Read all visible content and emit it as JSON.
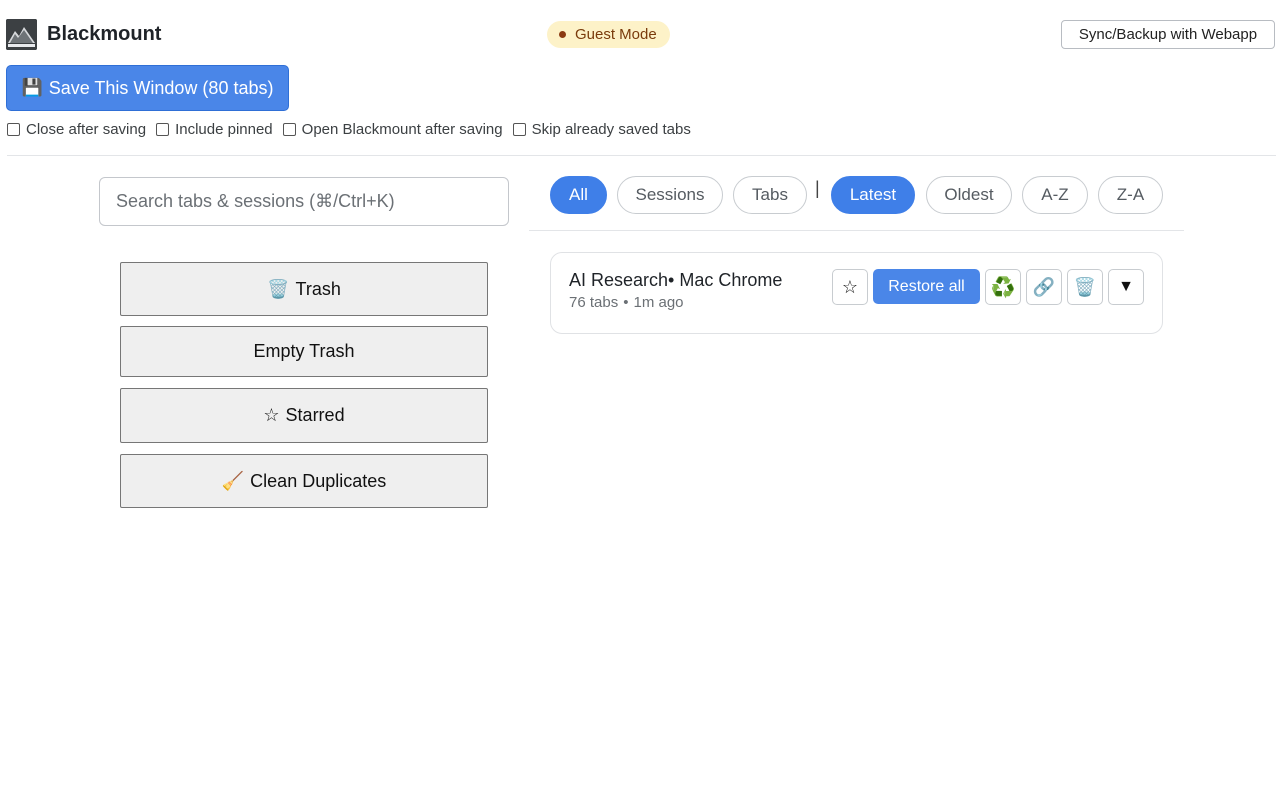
{
  "header": {
    "app_name": "Blackmount",
    "logo_text": "Blackmount",
    "guest_badge": "Guest Mode",
    "sync_label": "Sync/Backup with Webapp"
  },
  "save": {
    "icon": "floppy-disk-icon",
    "label": "Save This Window (80 tabs)"
  },
  "options": [
    {
      "label": "Close after saving",
      "checked": false
    },
    {
      "label": "Include pinned",
      "checked": false
    },
    {
      "label": "Open Blackmount after saving",
      "checked": false
    },
    {
      "label": "Skip already saved tabs",
      "checked": false
    }
  ],
  "search": {
    "placeholder": "Search tabs & sessions (⌘/Ctrl+K)",
    "value": ""
  },
  "sidebar": {
    "trash_icon": "🗑️",
    "trash_label": "Trash",
    "empty_trash_label": "Empty Trash",
    "starred_icon": "☆",
    "starred_label": "Starred",
    "clean_icon": "🧹",
    "clean_label": "Clean Duplicates"
  },
  "filters": {
    "type": [
      "All",
      "Sessions",
      "Tabs"
    ],
    "type_selected": "All",
    "separator": "|",
    "sort": [
      "Latest",
      "Oldest",
      "A-Z",
      "Z-A"
    ],
    "sort_selected": "Latest"
  },
  "sessions": [
    {
      "title": "AI Research• Mac Chrome",
      "tab_count": "76 tabs",
      "separator": "•",
      "age": "1m ago",
      "restore_label": "Restore all",
      "actions": {
        "star": "☆",
        "recycle": "♻️",
        "link": "🔗",
        "trash": "🗑️",
        "more": "▼"
      }
    }
  ],
  "colors": {
    "accent": "#4a86e8",
    "badge_bg": "#fdf2c8",
    "badge_text": "#7a3b0c"
  }
}
